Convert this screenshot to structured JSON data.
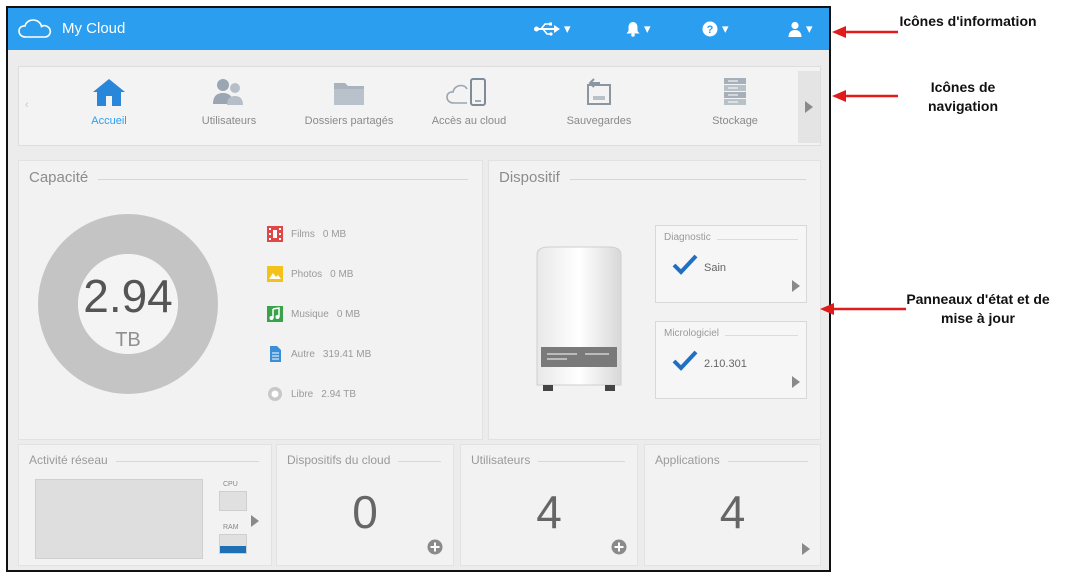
{
  "header": {
    "app_title": "My Cloud",
    "icons": [
      "usb-icon",
      "bell-icon",
      "help-icon",
      "user-icon"
    ],
    "accent_color": "#2c9ef0"
  },
  "nav": {
    "items": [
      {
        "label": "Accueil",
        "icon": "home-icon",
        "active": true
      },
      {
        "label": "Utilisateurs",
        "icon": "users-icon",
        "active": false
      },
      {
        "label": "Dossiers partagés",
        "icon": "folder-icon",
        "active": false
      },
      {
        "label": "Accès au cloud",
        "icon": "cloud-device-icon",
        "active": false
      },
      {
        "label": "Sauvegardes",
        "icon": "backup-icon",
        "active": false
      },
      {
        "label": "Stockage",
        "icon": "storage-icon",
        "active": false
      }
    ]
  },
  "capacity": {
    "title": "Capacité",
    "value": "2.94",
    "unit": "TB",
    "legend": [
      {
        "label": "Films",
        "value": "0 MB",
        "color": "#e04848"
      },
      {
        "label": "Photos",
        "value": "0 MB",
        "color": "#f2c21b"
      },
      {
        "label": "Musique",
        "value": "0 MB",
        "color": "#3aa34a"
      },
      {
        "label": "Autre",
        "value": "319.41 MB",
        "color": "#3a8fd6"
      },
      {
        "label": "Libre",
        "value": "2.94 TB",
        "color": "#c8c8c8"
      }
    ]
  },
  "device": {
    "title": "Dispositif",
    "diagnostic": {
      "title": "Diagnostic",
      "value": "Sain"
    },
    "firmware": {
      "title": "Micrologiciel",
      "value": "2.10.301"
    }
  },
  "bottom": {
    "activity": {
      "title": "Activité réseau",
      "cpu_label": "CPU",
      "ram_label": "RAM",
      "ram_level": 0.4
    },
    "cloud_devices": {
      "title": "Dispositifs du cloud",
      "count": "0"
    },
    "users": {
      "title": "Utilisateurs",
      "count": "4"
    },
    "apps": {
      "title": "Applications",
      "count": "4"
    }
  },
  "annotations": {
    "info_icons": "Icônes d'information",
    "nav_icons": "Icônes de navigation",
    "status_panels": "Panneaux d'état et de mise à jour"
  }
}
